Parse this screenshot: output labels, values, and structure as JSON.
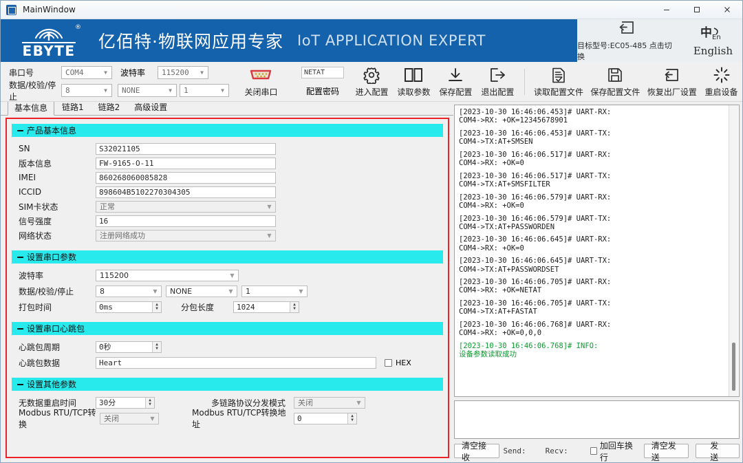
{
  "window": {
    "title": "MainWindow",
    "minimize": "–",
    "maximize": "□",
    "close": "✕"
  },
  "banner": {
    "logo_text": "EBYTE",
    "registered_mark": "®",
    "title_cn": "亿佰特·物联网应用专家",
    "title_en": "IoT APPLICATION EXPERT",
    "model_label": "目标型号:EC05-485 点击切换",
    "language_label": "English"
  },
  "toolbar": {
    "serial": {
      "port_label": "串口号",
      "port_value": "COM4",
      "baud_label": "波特率",
      "baud_value": "115200",
      "frame_label": "数据/校验/停止",
      "data_bits": "8",
      "parity": "NONE",
      "stop_bits": "1",
      "close_port_label": "关闭串口"
    },
    "password": {
      "value": "NETAT",
      "label": "配置密码"
    },
    "buttons": [
      {
        "name": "enter-config",
        "label": "进入配置"
      },
      {
        "name": "read-params",
        "label": "读取参数"
      },
      {
        "name": "save-config",
        "label": "保存配置"
      },
      {
        "name": "exit-config",
        "label": "退出配置"
      },
      {
        "name": "read-config-file",
        "label": "读取配置文件"
      },
      {
        "name": "save-config-file",
        "label": "保存配置文件"
      },
      {
        "name": "factory-reset",
        "label": "恢复出厂设置"
      },
      {
        "name": "reboot-device",
        "label": "重启设备"
      }
    ]
  },
  "tabs": [
    {
      "label": "基本信息",
      "active": true
    },
    {
      "label": "链路1",
      "active": false
    },
    {
      "label": "链路2",
      "active": false
    },
    {
      "label": "高级设置",
      "active": false
    }
  ],
  "sections": {
    "product": {
      "title": "产品基本信息",
      "fields": {
        "sn_label": "SN",
        "sn_value": "S32021105",
        "version_label": "版本信息",
        "version_value": "FW-9165-O-11",
        "imei_label": "IMEI",
        "imei_value": "860268060085828",
        "iccid_label": "ICCID",
        "iccid_value": "898604B5102270304305",
        "sim_label": "SIM卡状态",
        "sim_value": "正常",
        "signal_label": "信号强度",
        "signal_value": "16",
        "network_label": "网络状态",
        "network_value": "注册网络成功"
      }
    },
    "serial_params": {
      "title": "设置串口参数",
      "fields": {
        "baud_label": "波特率",
        "baud_value": "115200",
        "frame_label": "数据/校验/停止",
        "data_bits": "8",
        "parity": "NONE",
        "stop_bits": "1",
        "pack_time_label": "打包时间",
        "pack_time_value": "0ms",
        "pack_len_label": "分包长度",
        "pack_len_value": "1024"
      }
    },
    "heartbeat": {
      "title": "设置串口心跳包",
      "fields": {
        "period_label": "心跳包周期",
        "period_value": "0秒",
        "data_label": "心跳包数据",
        "data_value": "Heart",
        "hex_label": "HEX"
      }
    },
    "other": {
      "title": "设置其他参数",
      "fields": {
        "nodata_reboot_label": "无数据重启时间",
        "nodata_reboot_value": "30分",
        "multilink_label": "多链路协议分发模式",
        "multilink_value": "关闭",
        "modbus_label": "Modbus RTU/TCP转换",
        "modbus_value": "关闭",
        "modbus_addr_label": "Modbus RTU/TCP转换地址",
        "modbus_addr_value": "0"
      }
    }
  },
  "log": {
    "entries": [
      {
        "header": "[2023-10-30 16:46:06.453]# UART-RX:",
        "body": "COM4->RX: +OK=12345678901",
        "type": "normal"
      },
      {
        "header": "[2023-10-30 16:46:06.453]# UART-TX:",
        "body": "COM4->TX:AT+SMSEN",
        "type": "normal"
      },
      {
        "header": "[2023-10-30 16:46:06.517]# UART-RX:",
        "body": "COM4->RX: +OK=0",
        "type": "normal"
      },
      {
        "header": "[2023-10-30 16:46:06.517]# UART-TX:",
        "body": "COM4->TX:AT+SMSFILTER",
        "type": "normal"
      },
      {
        "header": "[2023-10-30 16:46:06.579]# UART-RX:",
        "body": "COM4->RX: +OK=0",
        "type": "normal"
      },
      {
        "header": "[2023-10-30 16:46:06.579]# UART-TX:",
        "body": "COM4->TX:AT+PASSWORDEN",
        "type": "normal"
      },
      {
        "header": "[2023-10-30 16:46:06.645]# UART-RX:",
        "body": "COM4->RX: +OK=0",
        "type": "normal"
      },
      {
        "header": "[2023-10-30 16:46:06.645]# UART-TX:",
        "body": "COM4->TX:AT+PASSWORDSET",
        "type": "normal"
      },
      {
        "header": "[2023-10-30 16:46:06.705]# UART-RX:",
        "body": "COM4->RX: +OK=NETAT",
        "type": "normal"
      },
      {
        "header": "[2023-10-30 16:46:06.705]# UART-TX:",
        "body": "COM4->TX:AT+FASTAT",
        "type": "normal"
      },
      {
        "header": "[2023-10-30 16:46:06.768]# UART-RX:",
        "body": "COM4->RX: +OK=0,0,0",
        "type": "normal"
      },
      {
        "header": "[2023-10-30 16:46:06.768]# INFO:",
        "body": "设备参数读取成功",
        "type": "info"
      }
    ]
  },
  "bottom": {
    "clear_recv": "清空接收",
    "send_stat": "Send:",
    "recv_stat": "Recv:",
    "crlf_label": "加回车换行",
    "clear_send": "清空发送",
    "send": "发送"
  },
  "colors": {
    "brand_blue": "#1562ac",
    "section_cyan": "#28e9ec",
    "panel_border_red": "#ec2227",
    "info_green": "#0a9c2e"
  }
}
